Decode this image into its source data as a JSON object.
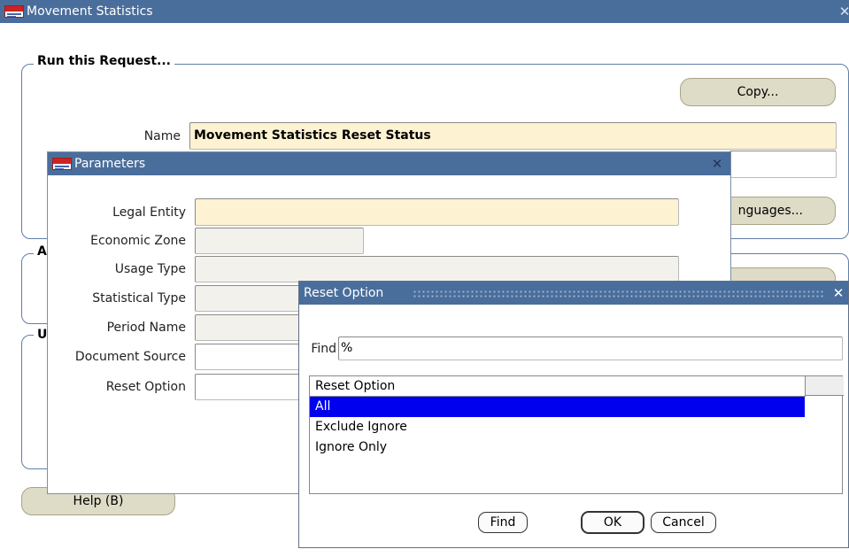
{
  "main_window": {
    "title": "Movement Statistics",
    "close_icon": "close-icon",
    "group1_legend": "Run this Request...",
    "copy_button": "Copy...",
    "name_label": "Name",
    "name_value": "Movement Statistics Reset Status",
    "languages_button": "nguages...",
    "group2_legend": "A",
    "group3_legend": "U",
    "help_button": "Help (B)"
  },
  "parameters": {
    "title": "Parameters",
    "fields": [
      {
        "label": "Legal Entity",
        "value": ""
      },
      {
        "label": "Economic Zone",
        "value": ""
      },
      {
        "label": "Usage Type",
        "value": ""
      },
      {
        "label": "Statistical Type",
        "value": ""
      },
      {
        "label": "Period Name",
        "value": ""
      },
      {
        "label": "Document Source",
        "value": ""
      },
      {
        "label": "Reset Option",
        "value": ""
      }
    ]
  },
  "lov": {
    "title": "Reset Option",
    "find_label": "Find",
    "find_value": "%",
    "column_header": "Reset Option",
    "options": [
      "All",
      "Exclude Ignore",
      "Ignore Only"
    ],
    "selected_index": 0,
    "find_button": "Find",
    "ok_button": "OK",
    "cancel_button": "Cancel"
  },
  "colors": {
    "titlebar": "#4a6e9c",
    "required_field": "#fdf2d2",
    "selection": "#0000ee",
    "button": "#dedbc6"
  }
}
